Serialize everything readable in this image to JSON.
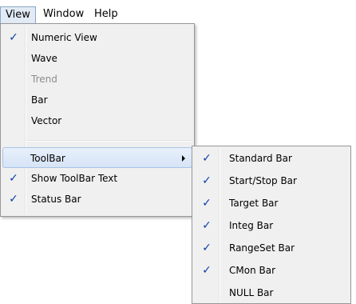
{
  "menubar": {
    "items": [
      {
        "label": "View",
        "active": true
      },
      {
        "label": "Window",
        "active": false
      },
      {
        "label": "Help",
        "active": false
      }
    ]
  },
  "view_menu": {
    "items": [
      {
        "label": "Numeric View",
        "checked": true,
        "enabled": true
      },
      {
        "label": "Wave",
        "checked": false,
        "enabled": true
      },
      {
        "label": "Trend",
        "checked": false,
        "enabled": false
      },
      {
        "label": "Bar",
        "checked": false,
        "enabled": true
      },
      {
        "label": "Vector",
        "checked": false,
        "enabled": true
      },
      {
        "label": "ToolBar",
        "checked": false,
        "enabled": true,
        "submenu": true,
        "highlighted": true
      },
      {
        "label": "Show ToolBar Text",
        "checked": true,
        "enabled": true
      },
      {
        "label": "Status Bar",
        "checked": true,
        "enabled": true
      }
    ]
  },
  "toolbar_submenu": {
    "items": [
      {
        "label": "Standard Bar",
        "checked": true
      },
      {
        "label": "Start/Stop Bar",
        "checked": true
      },
      {
        "label": "Target Bar",
        "checked": true
      },
      {
        "label": "Integ Bar",
        "checked": true
      },
      {
        "label": "RangeSet Bar",
        "checked": true
      },
      {
        "label": "CMon Bar",
        "checked": true
      },
      {
        "label": "NULL Bar",
        "checked": false
      }
    ]
  },
  "check_glyph": "✓",
  "colors": {
    "menu_background": "#f0f0f0",
    "menu_border": "#979797",
    "highlight": "#d6e4f6",
    "check": "#0b3fa8",
    "disabled_text": "#8d8d8d"
  }
}
